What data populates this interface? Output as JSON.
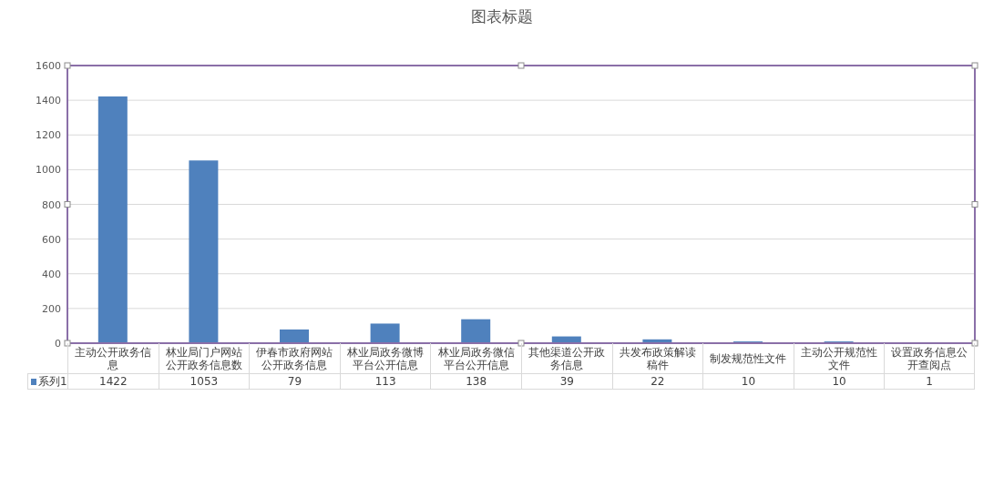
{
  "chart_data": {
    "type": "bar",
    "title": "图表标题",
    "categories": [
      "主动公开政务信息",
      "林业局门户网站公开政务信息数",
      "伊春市政府网站公开政务信息",
      "林业局政务微博平台公开信息",
      "林业局政务微信平台公开信息",
      "其他渠道公开政务信息",
      "共发布政策解读稿件",
      "制发规范性文件",
      "主动公开规范性文件",
      "设置政务信息公开查阅点"
    ],
    "series": [
      {
        "name": "系列1",
        "color": "#4f81bd",
        "values": [
          1422,
          1053,
          79,
          113,
          138,
          39,
          22,
          10,
          10,
          1
        ]
      }
    ],
    "ylim": [
      0,
      1600
    ],
    "grid": true,
    "yticks": [
      0,
      200,
      400,
      600,
      800,
      1000,
      1200,
      1400,
      1600
    ]
  },
  "data_table": {
    "values": [
      "1422",
      "1053",
      "79",
      "113",
      "138",
      "39",
      "22",
      "10",
      "10",
      "1"
    ]
  }
}
